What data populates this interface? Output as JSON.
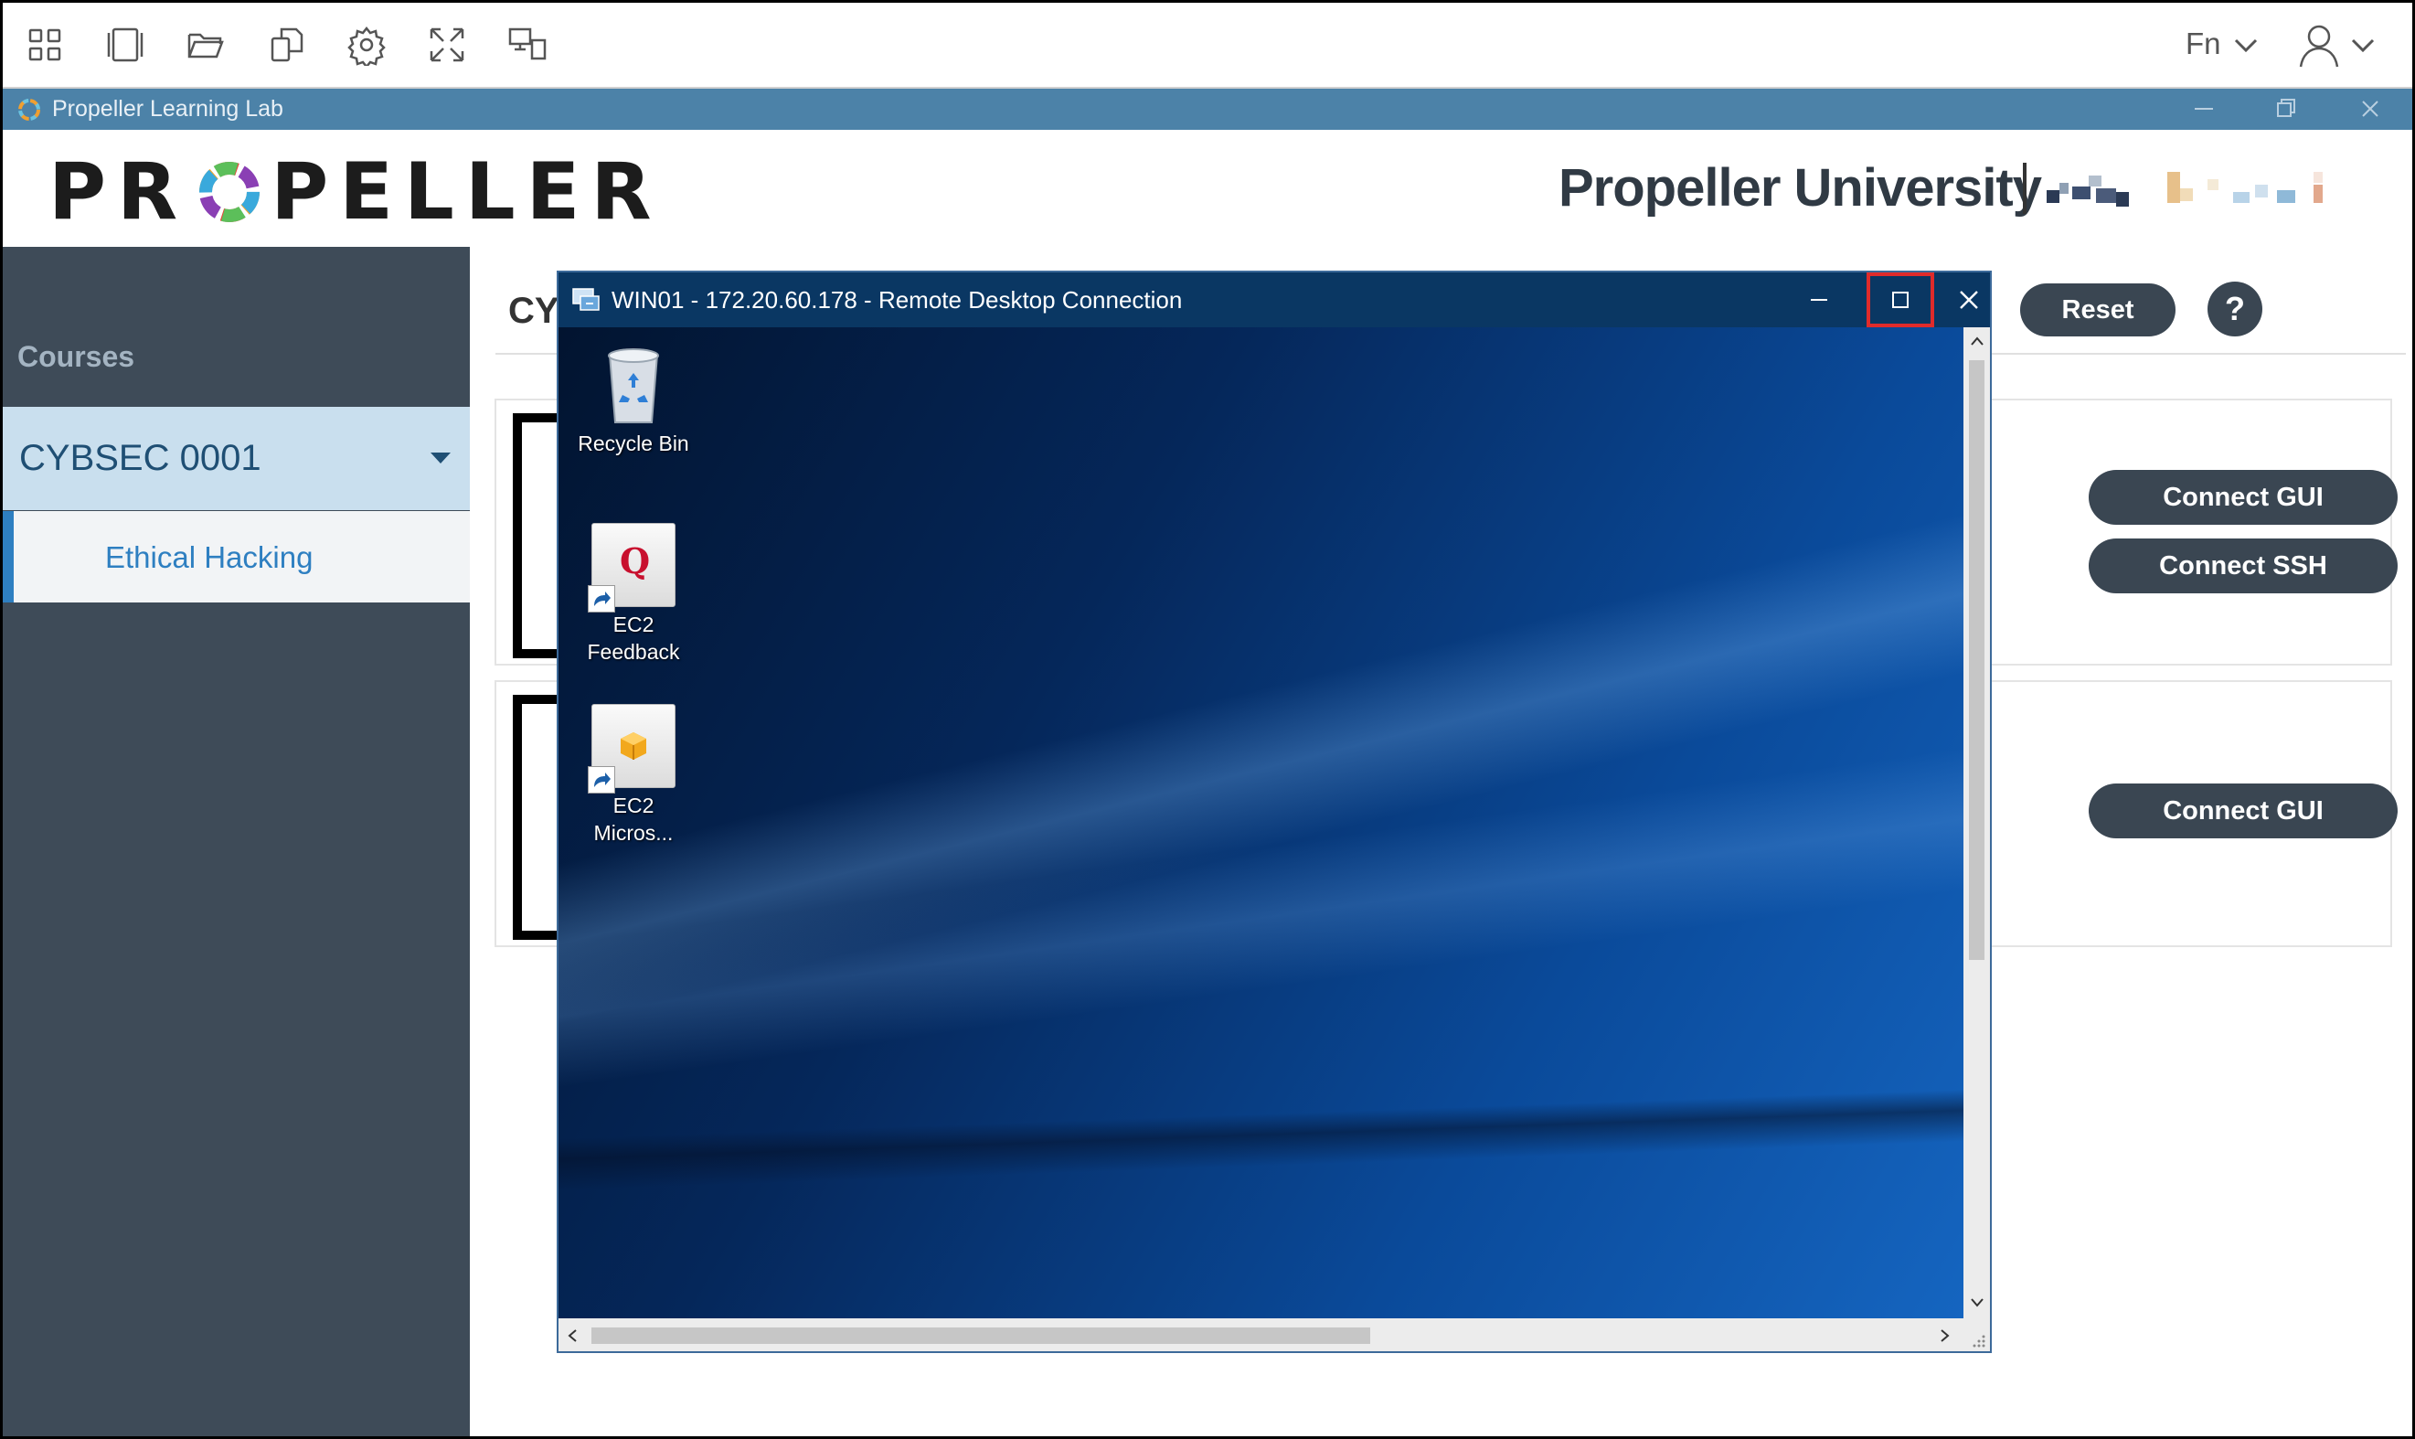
{
  "toolbar": {
    "icons": [
      "apps-grid-icon",
      "split-view-icon",
      "folder-open-icon",
      "copy-icon",
      "gear-icon",
      "fullscreen-icon",
      "remote-display-icon"
    ],
    "fn_label": "Fn"
  },
  "app_window": {
    "title": "Propeller Learning Lab"
  },
  "header": {
    "brand_left": "PR",
    "brand_right": "PELLER",
    "university": "Propeller University"
  },
  "sidebar": {
    "section_label": "Courses",
    "course": "CYBSEC 0001",
    "sub_item": "Ethical Hacking"
  },
  "main": {
    "heading_partial": "CY",
    "reset_label": "Reset",
    "help_label": "?",
    "cards": [
      {
        "buttons": [
          "Connect GUI",
          "Connect SSH"
        ]
      },
      {
        "buttons": [
          "Connect GUI"
        ]
      }
    ]
  },
  "rdp": {
    "title": "WIN01 - 172.20.60.178 - Remote Desktop Connection",
    "desktop_icons": [
      {
        "label": "Recycle Bin"
      },
      {
        "label": "EC2 Feedback",
        "glyph": "Q"
      },
      {
        "label_line1": "EC2",
        "label_line2": "Micros..."
      }
    ]
  },
  "colors": {
    "app_title_bar": "#4c82a8",
    "sidebar_bg": "#3e4b58",
    "course_highlight": "#c9dfee",
    "accent_blue": "#2e7fc1",
    "pill_button": "#3a4652",
    "rdp_title_bar": "#0a3763",
    "highlight_box": "#e02b2b"
  }
}
